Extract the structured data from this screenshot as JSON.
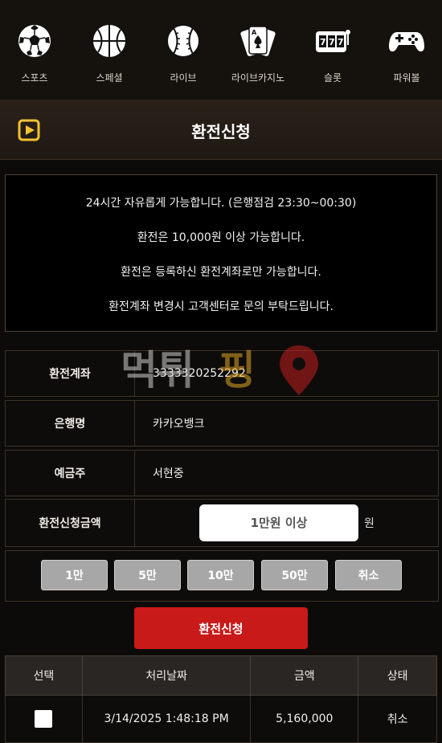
{
  "nav": {
    "items": [
      {
        "label": "스포츠",
        "icon": "soccer-ball-icon"
      },
      {
        "label": "스페셜",
        "icon": "basketball-icon"
      },
      {
        "label": "라이브",
        "icon": "baseball-icon"
      },
      {
        "label": "라이브카지노",
        "icon": "playing-cards-icon"
      },
      {
        "label": "슬롯",
        "icon": "slot-machine-icon"
      },
      {
        "label": "파워볼",
        "icon": "gamepad-icon"
      }
    ]
  },
  "header": {
    "title": "환전신청",
    "icon": "play-square-icon"
  },
  "notice": {
    "lines": [
      "24시간 자유롭게 가능합니다. (은행점검 23:30~00:30)",
      "환전은 10,000원 이상 가능합니다.",
      "환전은 등록하신 환전계좌로만 가능합니다.",
      "환전계좌 변경시 고객센터로 문의 부탁드립니다."
    ]
  },
  "form": {
    "account_label": "환전계좌",
    "account_value": "3333320252292",
    "bank_label": "은행명",
    "bank_value": "카카오뱅크",
    "holder_label": "예금주",
    "holder_value": "서현중",
    "amount_label": "환전신청금액",
    "amount_placeholder": "1만원 이상",
    "amount_unit": "원"
  },
  "quick_buttons": [
    "1만",
    "5만",
    "10만",
    "50만",
    "취소"
  ],
  "submit_label": "환전신청",
  "table": {
    "headers": [
      "선택",
      "처리날짜",
      "금액",
      "상태"
    ],
    "rows": [
      {
        "date": "3/14/2025 1:48:18 PM",
        "amount": "5,160,000",
        "status": "취소"
      }
    ]
  },
  "watermark": {
    "text": "먹튀핑"
  },
  "colors": {
    "accent_red": "#c91a1a",
    "icon_yellow": "#f2c230",
    "button_gray": "#a7a7a7"
  }
}
